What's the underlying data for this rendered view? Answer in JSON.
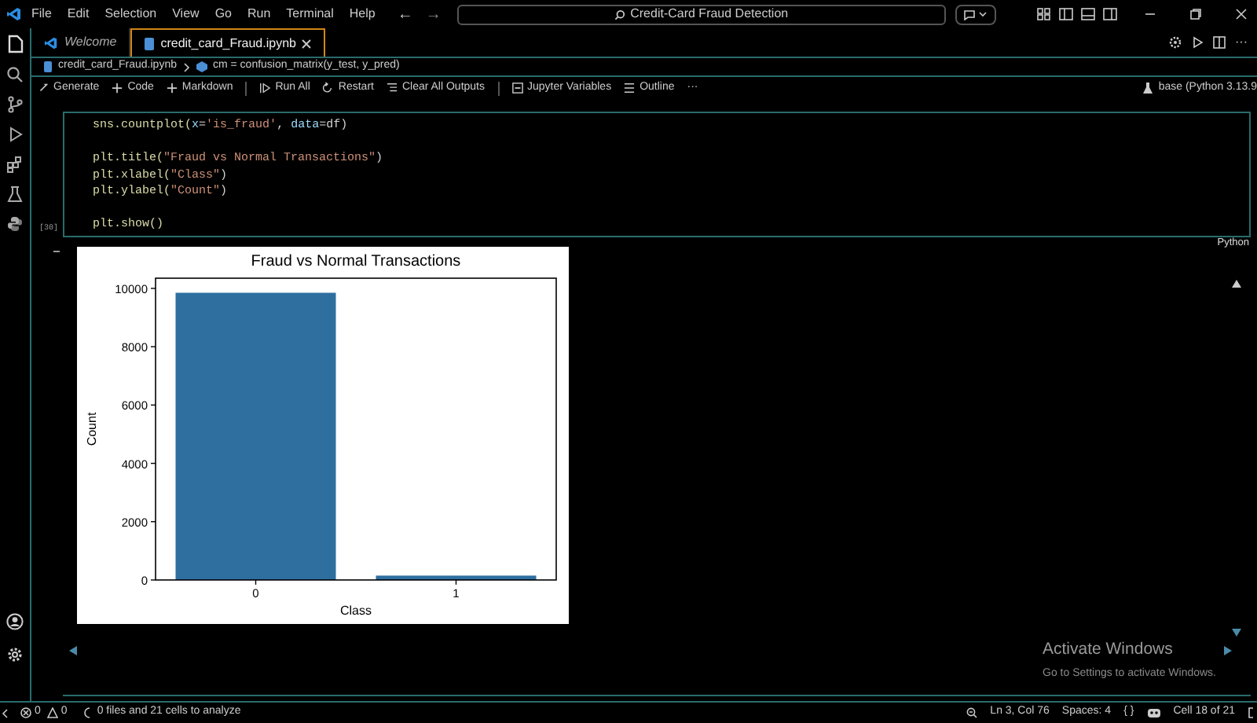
{
  "menu": [
    "File",
    "Edit",
    "Selection",
    "View",
    "Go",
    "Run",
    "Terminal",
    "Help"
  ],
  "nav": {
    "back": "←",
    "forward": "→"
  },
  "search": {
    "value": "Credit-Card Fraud Detection"
  },
  "editor_actions_more": "···",
  "tabs": [
    {
      "label": "Welcome",
      "selected": false
    },
    {
      "label": "credit_card_Fraud.ipynb",
      "selected": true
    }
  ],
  "breadcrumb": [
    "credit_card_Fraud.ipynb",
    "cm = confusion_matrix(y_test, y_pred)"
  ],
  "toolbar": [
    "Generate",
    "Code",
    "Markdown",
    "Run All",
    "Restart",
    "Clear All Outputs",
    "Jupyter Variables",
    "Outline"
  ],
  "toolbar_more": "···",
  "kernel": "base (Python 3.13.9",
  "cell": {
    "code": [
      {
        "gap_before": false,
        "tokens": [
          {
            "text": "sns.countplot(",
            "kind": "function"
          },
          {
            "text": "x",
            "kind": "param"
          },
          {
            "text": "=",
            "kind": "plain"
          },
          {
            "text": "'is_fraud'",
            "kind": "string"
          },
          {
            "text": ", ",
            "kind": "plain"
          },
          {
            "text": "data",
            "kind": "param"
          },
          {
            "text": "=df)",
            "kind": "plain"
          }
        ]
      },
      {
        "gap_before": true,
        "tokens": [
          {
            "text": "plt.title(",
            "kind": "function"
          },
          {
            "text": "\"Fraud vs Normal Transactions\"",
            "kind": "string"
          },
          {
            "text": ")",
            "kind": "plain"
          }
        ]
      },
      {
        "gap_before": false,
        "tokens": [
          {
            "text": "plt.xlabel(",
            "kind": "function"
          },
          {
            "text": "\"Class\"",
            "kind": "string"
          },
          {
            "text": ")",
            "kind": "plain"
          }
        ]
      },
      {
        "gap_before": false,
        "tokens": [
          {
            "text": "plt.ylabel(",
            "kind": "function"
          },
          {
            "text": "\"Count\"",
            "kind": "string"
          },
          {
            "text": ")",
            "kind": "plain"
          }
        ]
      },
      {
        "gap_before": true,
        "tokens": [
          {
            "text": "plt.show()",
            "kind": "function"
          }
        ]
      }
    ],
    "execution_count": "[30]",
    "language": "Python"
  },
  "output": {
    "chart_data": {
      "type": "bar",
      "title": "Fraud vs Normal Transactions",
      "xlabel": "Class",
      "ylabel": "Count",
      "categories": [
        "0",
        "1"
      ],
      "series": [
        {
          "color": "#2e6fa0",
          "values": [
            9850,
            150
          ]
        }
      ],
      "ylim": [
        0,
        10350
      ],
      "yticks": [
        0,
        2000,
        4000,
        6000,
        8000,
        10000
      ]
    }
  },
  "os_notice": {
    "title": "Activate Windows",
    "text": "Go to Settings to activate Windows."
  },
  "status_bar": {
    "errors": "0",
    "warnings": "0",
    "analysis": "0 files and 21 cells to analyze",
    "position": "Ln 3, Col 76",
    "spaces": "Spaces: 4",
    "braces": "{ }",
    "cell": "Cell 18 of 21"
  }
}
